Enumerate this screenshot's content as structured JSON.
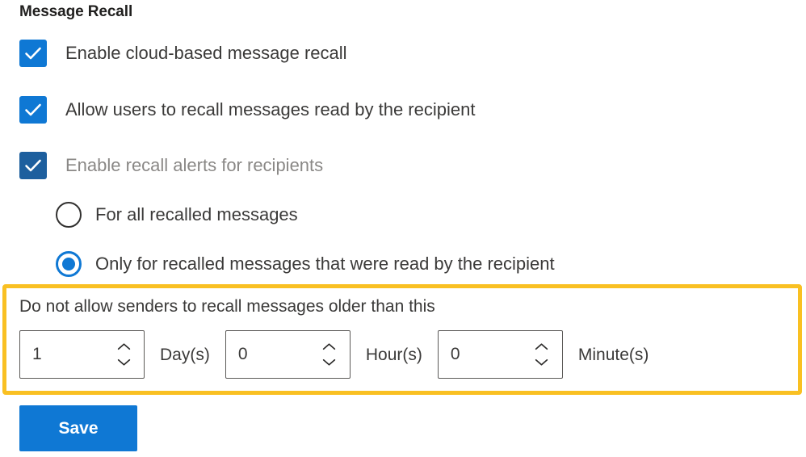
{
  "section": {
    "title": "Message Recall"
  },
  "colors": {
    "accent_blue": "#0F78D4",
    "accent_blue_dim": "#1D5F9E",
    "highlight_yellow": "#F9C022",
    "text_primary": "#3B3A39",
    "text_heading": "#201F1E",
    "text_disabled": "#8A8886",
    "input_border": "#5C5A58"
  },
  "checkboxes": [
    {
      "label": "Enable cloud-based message recall",
      "checked": true,
      "disabled": false,
      "icon": "checkmark-icon"
    },
    {
      "label": "Allow users to recall messages read by the recipient",
      "checked": true,
      "disabled": false,
      "icon": "checkmark-icon"
    },
    {
      "label": "Enable recall alerts for recipients",
      "checked": true,
      "disabled": true,
      "icon": "checkmark-icon"
    }
  ],
  "radio_group": {
    "options": [
      {
        "label": "For all recalled messages",
        "selected": false
      },
      {
        "label": "Only for recalled messages that were read by the recipient",
        "selected": true
      }
    ]
  },
  "duration": {
    "caption": "Do not allow senders to recall messages older than this",
    "highlighted": true,
    "fields": [
      {
        "value": "1",
        "unit_label": "Day(s)",
        "spin_up_icon": "chevron-up-icon",
        "spin_down_icon": "chevron-down-icon"
      },
      {
        "value": "0",
        "unit_label": "Hour(s)",
        "spin_up_icon": "chevron-up-icon",
        "spin_down_icon": "chevron-down-icon"
      },
      {
        "value": "0",
        "unit_label": "Minute(s)",
        "spin_up_icon": "chevron-up-icon",
        "spin_down_icon": "chevron-down-icon"
      }
    ]
  },
  "actions": {
    "save_label": "Save"
  }
}
